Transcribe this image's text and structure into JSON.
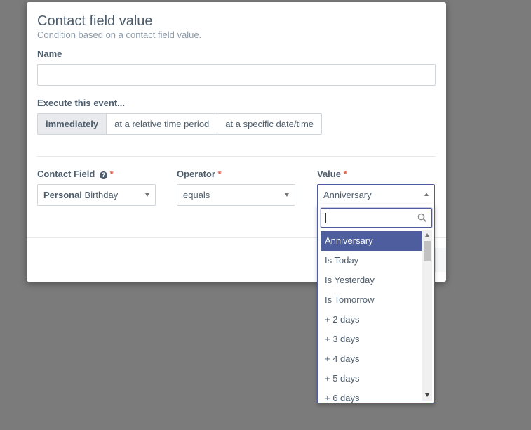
{
  "modal": {
    "title": "Contact field value",
    "subtitle": "Condition based on a contact field value."
  },
  "form": {
    "name_label": "Name",
    "name_value": "",
    "execute_label": "Execute this event...",
    "timing_options": [
      "immediately",
      "at a relative time period",
      "at a specific date/time"
    ],
    "timing_selected": "immediately",
    "contact_field_label": "Contact Field",
    "contact_field_group": "Personal",
    "contact_field_value": "Birthday",
    "operator_label": "Operator",
    "operator_value": "equals",
    "value_label": "Value",
    "value_selected": "Anniversary",
    "required_mark": "*",
    "help_glyph": "?"
  },
  "dropdown": {
    "search_value": "",
    "options": [
      "Anniversary",
      "Is Today",
      "Is Yesterday",
      "Is Tomorrow",
      "+ 2 days",
      "+ 3 days",
      "+ 4 days",
      "+ 5 days",
      "+ 6 days"
    ],
    "highlighted": "Anniversary"
  },
  "icons": {
    "help": "question-circle-icon",
    "search": "search-icon",
    "caret": "chevron-down-icon"
  },
  "colors": {
    "accent": "#4e5d9e",
    "required": "#e05a45",
    "text": "#4e5d6c",
    "backdrop": "#7b7b7b"
  }
}
